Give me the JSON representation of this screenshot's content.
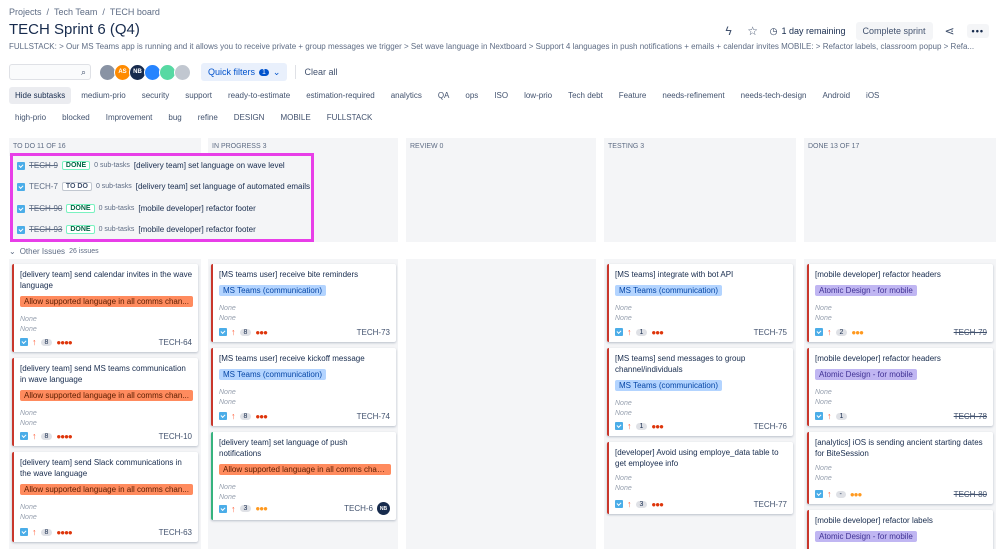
{
  "breadcrumb": [
    "Projects",
    "Tech Team",
    "TECH board"
  ],
  "title": "TECH Sprint 6 (Q4)",
  "header": {
    "remaining": "1 day remaining",
    "complete": "Complete sprint",
    "more": "•••"
  },
  "description": "FULLSTACK: > Our MS Teams app is running and it allows you to receive private + group messages we trigger > Set wave language in Nextboard > Support 4 languages in push notifications + emails + calendar invites MOBILE: > Refactor labels, classroom popup > Refa...",
  "toolbar": {
    "quick_filters": "Quick filters",
    "quick_count": "1",
    "clear_all": "Clear all"
  },
  "avatars": [
    {
      "initials": "",
      "color": "#8993a4"
    },
    {
      "initials": "AS",
      "color": "#ff8b00"
    },
    {
      "initials": "NB",
      "color": "#172b4d"
    },
    {
      "initials": "",
      "color": "#2684ff"
    },
    {
      "initials": "",
      "color": "#57d9a3"
    },
    {
      "initials": "",
      "color": "#c1c7d0"
    }
  ],
  "chips_row1": [
    "Hide subtasks",
    "medium-prio",
    "security",
    "support",
    "ready-to-estimate",
    "estimation-required",
    "analytics",
    "QA",
    "ops",
    "ISO",
    "low-prio",
    "Tech debt",
    "Feature",
    "needs-refinement",
    "needs-tech-design",
    "Android",
    "iOS"
  ],
  "chips_row2": [
    "high-prio",
    "blocked",
    "Improvement",
    "bug",
    "refine",
    "DESIGN",
    "MOBILE",
    "FULLSTACK"
  ],
  "columns": [
    "TO DO 11 of 16",
    "IN PROGRESS 3",
    "REVIEW 0",
    "TESTING 3",
    "DONE 13 of 17"
  ],
  "subtasks": [
    {
      "key": "TECH-9",
      "status": "DONE",
      "count": "0 sub-tasks",
      "title": "[delivery team] set language on wave level"
    },
    {
      "key": "TECH-7",
      "status": "TO DO",
      "count": "0 sub-tasks",
      "title": "[delivery team] set language of automated emails"
    },
    {
      "key": "TECH-90",
      "status": "DONE",
      "count": "0 sub-tasks",
      "title": "[mobile developer] refactor footer"
    },
    {
      "key": "TECH-93",
      "status": "DONE",
      "count": "0 sub-tasks",
      "title": "[mobile developer] refactor footer"
    }
  ],
  "other_issues": {
    "label": "Other Issues",
    "count": "26 issues"
  },
  "cards": {
    "c64": {
      "title": "[delivery team] send calendar invites in the wave language",
      "epic": "Allow supported language in all comms chan...",
      "none1": "None",
      "none2": "None",
      "est": "8",
      "key": "TECH-64"
    },
    "c10": {
      "title": "[delivery team] send MS teams communication in wave language",
      "epic": "Allow supported language in all comms chan...",
      "none1": "None",
      "none2": "None",
      "est": "8",
      "key": "TECH-10"
    },
    "c63": {
      "title": "[delivery team] send Slack communications in the wave language",
      "epic": "Allow supported language in all comms chan...",
      "none1": "None",
      "none2": "None",
      "est": "8",
      "key": "TECH-63"
    },
    "c73": {
      "title": "[MS teams user] receive bite reminders",
      "epic": "MS Teams (communication)",
      "none1": "None",
      "none2": "None",
      "est": "8",
      "key": "TECH-73"
    },
    "c74": {
      "title": "[MS teams user] receive kickoff message",
      "epic": "MS Teams (communication)",
      "none1": "None",
      "none2": "None",
      "est": "8",
      "key": "TECH-74"
    },
    "c6": {
      "title": "[delivery team] set language of push notifications",
      "epic": "Allow supported language in all comms chan...",
      "none1": "None",
      "none2": "None",
      "est": "3",
      "key": "TECH-6",
      "assignee": "NB"
    },
    "c75": {
      "title": "[MS teams] integrate with bot API",
      "epic": "MS Teams (communication)",
      "none1": "None",
      "none2": "None",
      "est": "1",
      "key": "TECH-75"
    },
    "c76": {
      "title": "[MS teams] send messages to group channel/individuals",
      "epic": "MS Teams (communication)",
      "none1": "None",
      "none2": "None",
      "est": "1",
      "key": "TECH-76"
    },
    "c77": {
      "title": "[developer] Avoid using employe_data table to get employee info",
      "none1": "None",
      "none2": "None",
      "est": "3",
      "key": "TECH-77"
    },
    "c79": {
      "title": "[mobile developer] refactor headers",
      "epic": "Atomic Design - for mobile",
      "none1": "None",
      "none2": "None",
      "est": "2",
      "key": "TECH-79"
    },
    "c78": {
      "title": "[mobile developer] refactor headers",
      "epic": "Atomic Design - for mobile",
      "none1": "None",
      "none2": "None",
      "est": "1",
      "key": "TECH-78"
    },
    "c80": {
      "title": "[analytics] iOS is sending ancient starting dates for BiteSession",
      "none1": "None",
      "none2": "None",
      "est": "-",
      "key": "TECH-80"
    },
    "cLabels": {
      "title": "[mobile developer] refactor labels",
      "epic": "Atomic Design - for mobile"
    }
  }
}
